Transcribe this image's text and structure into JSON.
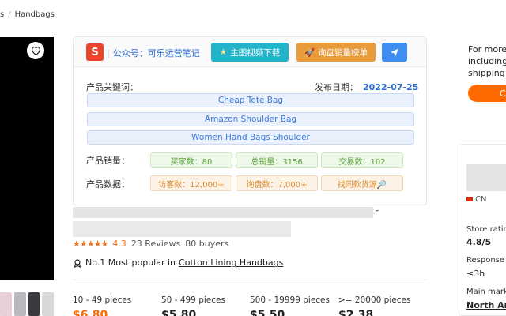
{
  "breadcrumb": {
    "prev_label": "s",
    "current_label": "Handbags"
  },
  "media": {
    "heart_icon": "heart-outline-icon"
  },
  "plugin": {
    "logo_letter": "S",
    "account_label": "公众号：可乐运营笔记",
    "video_button_label": "主图视频下载",
    "rank_button_label": "询盘销量榜单",
    "keywords_label": "产品关键词：",
    "date_label": "发布日期：",
    "date_value": "2022-07-25",
    "keywords": [
      "Cheap Tote Bag",
      "Amazon Shoulder Bag",
      "Women Hand Bags Shoulder"
    ],
    "sales_label": "产品销量：",
    "sales": [
      "买家数：80",
      "总销量：3156",
      "交易数：102"
    ],
    "data_label": "产品数据：",
    "data": [
      "访客数：12,000+",
      "询盘数：7,000+",
      "找同款货源🔎"
    ]
  },
  "product": {
    "title_tail": "r",
    "rating_value": "4.3",
    "reviews_label": "23 Reviews",
    "buyers_label": "80 buyers",
    "popular_prefix": "No.1 Most popular in",
    "popular_link": "Cotton Lining Handbags"
  },
  "pricing": {
    "tiers": [
      "10 - 49 pieces",
      "50 - 499 pieces",
      "500 - 19999 pieces",
      ">= 20000 pieces"
    ],
    "prices": [
      "$6.80",
      "$5.80",
      "$5.50",
      "$2.38"
    ]
  },
  "sidebar": {
    "info_lines": [
      "For more",
      "including",
      "shipping:"
    ],
    "button_label": "C",
    "country": "CN",
    "store_rating_label": "Store rating",
    "store_rating_value": "4.8/5",
    "response_label": "Response ti",
    "response_value": "≤3h",
    "market_label": "Main marke",
    "market_value": "North Am"
  },
  "colors": {
    "accent_orange": "#ff6a00",
    "link_blue": "#2a6fd6",
    "star_orange": "#ec6b1b"
  }
}
